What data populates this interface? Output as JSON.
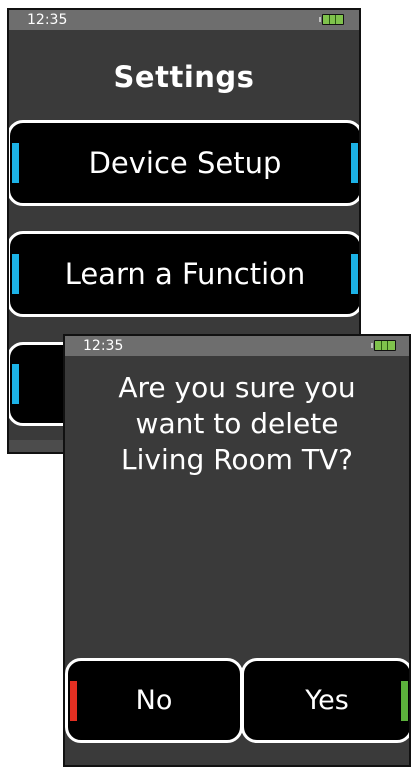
{
  "settings_screen": {
    "status_time": "12:35",
    "title": "Settings",
    "menu_items": [
      {
        "label": "Device Setup",
        "accent_color": "#1cb2e6"
      },
      {
        "label": "Learn a Function",
        "accent_color": "#1cb2e6"
      }
    ]
  },
  "dialog_screen": {
    "status_time": "12:35",
    "message_lines": [
      "Are you sure you",
      "want to delete",
      "Living Room TV?"
    ],
    "no_label": "No",
    "yes_label": "Yes",
    "no_accent_color": "#e32f22",
    "yes_accent_color": "#5cb23c"
  },
  "colors": {
    "screen_background": "#3a3a3a",
    "status_bar": "#6e6e6e",
    "button_background": "#000000",
    "button_border": "#ffffff",
    "battery": "#7fc24c"
  }
}
